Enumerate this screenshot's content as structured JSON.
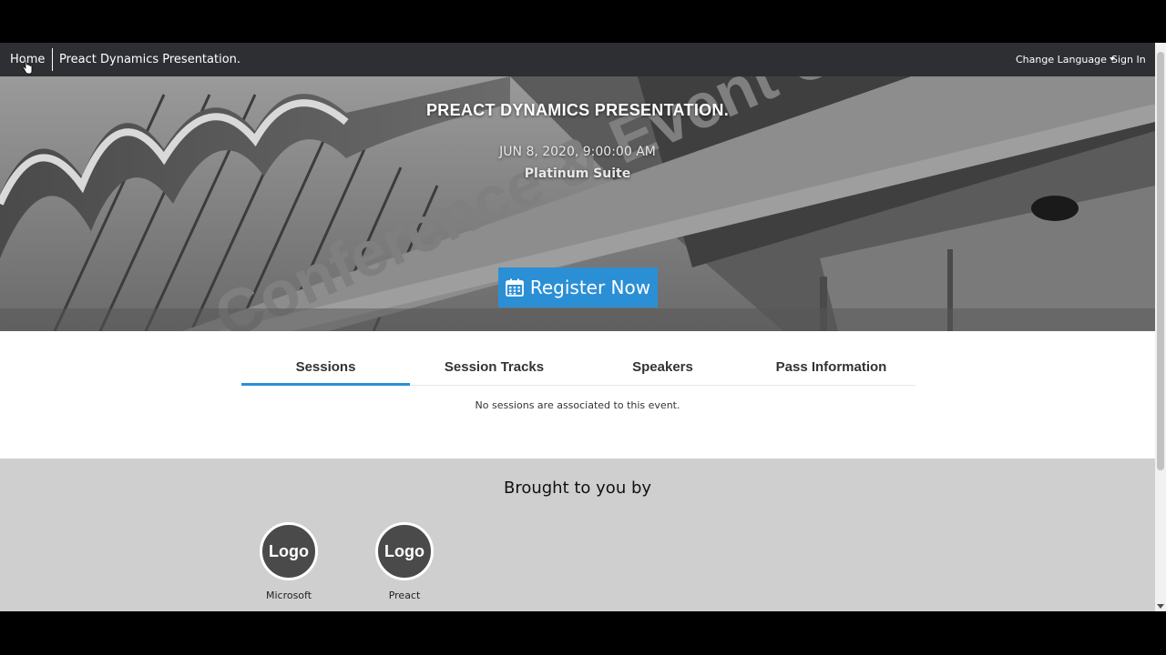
{
  "nav": {
    "home": "Home",
    "event_name": "Preact Dynamics Presentation.",
    "change_language": "Change Language",
    "sign_in": "Sign In"
  },
  "hero": {
    "title": "PREACT DYNAMICS PRESENTATION.",
    "date": "JUN 8, 2020, 9:00:00 AM",
    "venue": "Platinum Suite",
    "register_label": "Register Now",
    "register_icon": "calendar-icon",
    "background_text": "Conference & Event Centre"
  },
  "tabs": [
    {
      "label": "Sessions",
      "active": true
    },
    {
      "label": "Session Tracks",
      "active": false
    },
    {
      "label": "Speakers",
      "active": false
    },
    {
      "label": "Pass Information",
      "active": false
    }
  ],
  "sessions": {
    "empty_message": "No sessions are associated to this event."
  },
  "sponsors": {
    "title": "Brought to you by",
    "items": [
      {
        "logo_text": "Logo",
        "name": "Microsoft"
      },
      {
        "logo_text": "Logo",
        "name": "Preact"
      }
    ]
  },
  "colors": {
    "accent": "#2b8fd6",
    "navbar": "#2d2f33",
    "sponsor_bg": "#cfcfcf"
  }
}
